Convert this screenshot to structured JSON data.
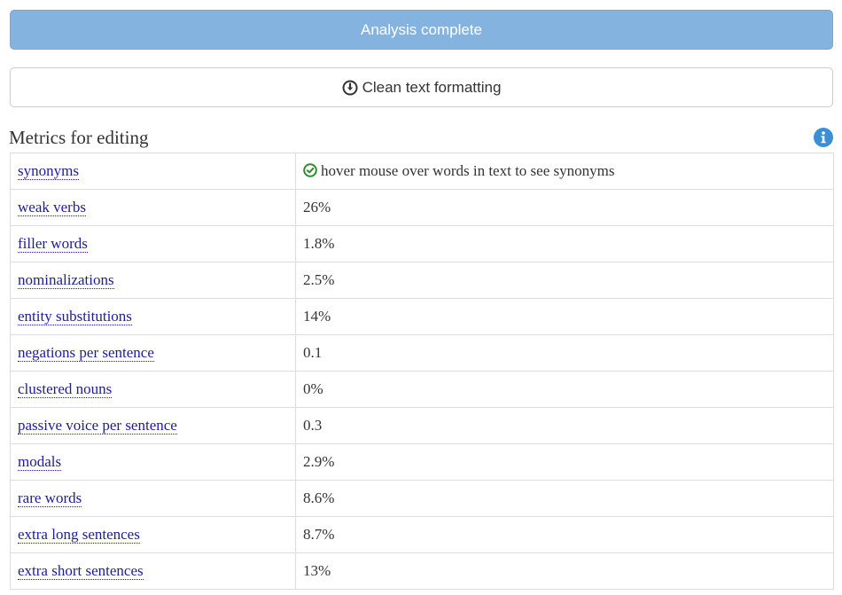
{
  "buttons": {
    "analysis": "Analysis complete",
    "clean": "Clean text formatting"
  },
  "section": {
    "title": "Metrics for editing"
  },
  "colors": {
    "primary_button": "#84b3df",
    "link": "#1d1d9a",
    "info_icon": "#3a8fd6",
    "check_icon": "#2e8b2e"
  },
  "metrics": [
    {
      "label": "synonyms",
      "value": "hover mouse over words in text to see synonyms",
      "icon": "check-circle-icon"
    },
    {
      "label": "weak verbs",
      "value": "26%"
    },
    {
      "label": "filler words",
      "value": "1.8%"
    },
    {
      "label": "nominalizations",
      "value": "2.5%"
    },
    {
      "label": "entity substitutions",
      "value": "14%"
    },
    {
      "label": "negations per sentence",
      "value": "0.1"
    },
    {
      "label": "clustered nouns",
      "value": "0%"
    },
    {
      "label": "passive voice per sentence",
      "value": "0.3"
    },
    {
      "label": "modals",
      "value": "2.9%"
    },
    {
      "label": "rare words",
      "value": "8.6%"
    },
    {
      "label": "extra long sentences",
      "value": "8.7%"
    },
    {
      "label": "extra short sentences",
      "value": "13%"
    }
  ]
}
